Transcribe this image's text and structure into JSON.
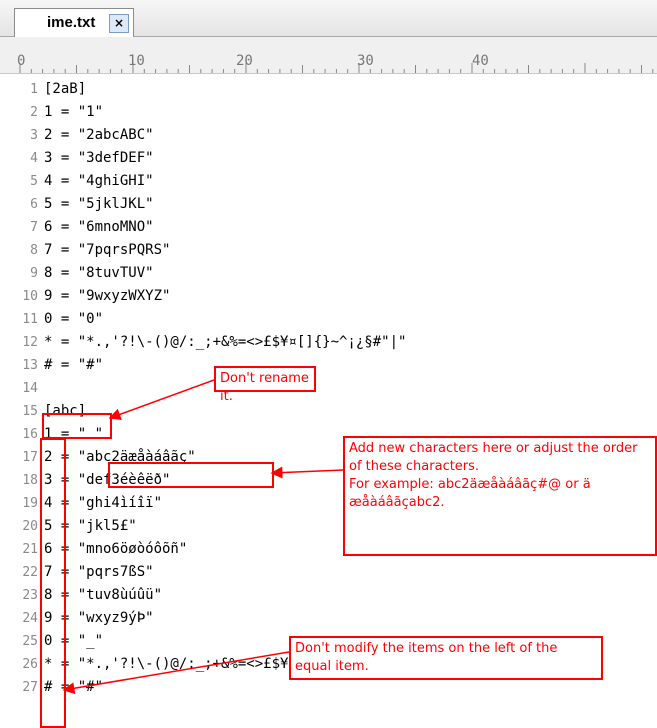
{
  "tab": {
    "label": "ime.txt",
    "close": "×"
  },
  "ruler": {
    "marks": [
      "0",
      "10",
      "20",
      "30",
      "40"
    ]
  },
  "lines": [
    {
      "n": "1",
      "t": "[2aB]"
    },
    {
      "n": "2",
      "t": "1 = \"1\""
    },
    {
      "n": "3",
      "t": "2 = \"2abcABC\""
    },
    {
      "n": "4",
      "t": "3 = \"3defDEF\""
    },
    {
      "n": "5",
      "t": "4 = \"4ghiGHI\""
    },
    {
      "n": "6",
      "t": "5 = \"5jklJKL\""
    },
    {
      "n": "7",
      "t": "6 = \"6mnoMNO\""
    },
    {
      "n": "8",
      "t": "7 = \"7pqrsPQRS\""
    },
    {
      "n": "9",
      "t": "8 = \"8tuvTUV\""
    },
    {
      "n": "10",
      "t": "9 = \"9wxyzWXYZ\""
    },
    {
      "n": "11",
      "t": "0 = \"0\""
    },
    {
      "n": "12",
      "t": "* = \"*.,'?!\\-()@/:_;+&%=<>£$¥¤[]{}~^¡¿§#\"|\""
    },
    {
      "n": "13",
      "t": "# = \"#\""
    },
    {
      "n": "14",
      "t": ""
    },
    {
      "n": "15",
      "t": "[abc]"
    },
    {
      "n": "16",
      "t": "1 = \" \""
    },
    {
      "n": "17",
      "t": "2 = \"abc2äæåàáâãç\""
    },
    {
      "n": "18",
      "t": "3 = \"def3éèêëð\""
    },
    {
      "n": "19",
      "t": "4 = \"ghi4ìíîï\""
    },
    {
      "n": "20",
      "t": "5 = \"jkl5£\""
    },
    {
      "n": "21",
      "t": "6 = \"mno6öøòóôõñ\""
    },
    {
      "n": "22",
      "t": "7 = \"pqrs7ßS\""
    },
    {
      "n": "23",
      "t": "8 = \"tuv8ùúûü\""
    },
    {
      "n": "24",
      "t": "9 = \"wxyz9ýÞ\""
    },
    {
      "n": "25",
      "t": "0 = \"_\""
    },
    {
      "n": "26",
      "t": "* = \"*.,'?!\\-()@/:_;+&%=<>£$¥¤[]{}~^¡¿§#\"|\""
    },
    {
      "n": "27",
      "t": "# = \"#\""
    }
  ],
  "annotations": {
    "rename": "Don't rename it.",
    "add_chars": "Add new characters here or adjust the order of these characters.",
    "example": "For example: abc2äæåàáâãç#@ or ä æåàáâãçabc2.",
    "modify": "Don't modify the items on the left of the equal item."
  },
  "colors": {
    "annotation": "#ff0000",
    "line_number": "#8a8a8a"
  }
}
